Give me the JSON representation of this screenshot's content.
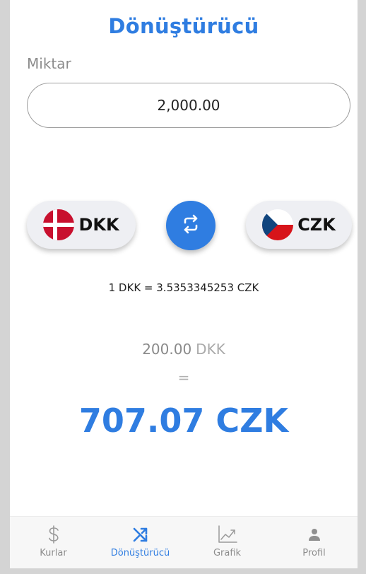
{
  "header": {
    "title": "Dönüştürücü"
  },
  "amount": {
    "label": "Miktar",
    "value": "2,000.00"
  },
  "currencies": {
    "from": {
      "code": "DKK",
      "flag_icon": "denmark-flag-icon"
    },
    "to": {
      "code": "CZK",
      "flag_icon": "czech-flag-icon"
    },
    "swap_icon": "swap-arrows-icon"
  },
  "rate_text": "1 DKK = 3.5353345253 CZK",
  "conversion": {
    "from_amount": "200.00",
    "from_code": "DKK",
    "equals": "=",
    "result": "707.07 CZK"
  },
  "tabs": [
    {
      "label": "Kurlar",
      "icon": "dollar-icon",
      "active": false
    },
    {
      "label": "Dönüştürücü",
      "icon": "shuffle-icon",
      "active": true
    },
    {
      "label": "Grafik",
      "icon": "chart-icon",
      "active": false
    },
    {
      "label": "Profil",
      "icon": "person-icon",
      "active": false
    }
  ],
  "colors": {
    "accent": "#2f7de1",
    "background": "#ffffff",
    "tabbar": "#f7f7f7"
  }
}
